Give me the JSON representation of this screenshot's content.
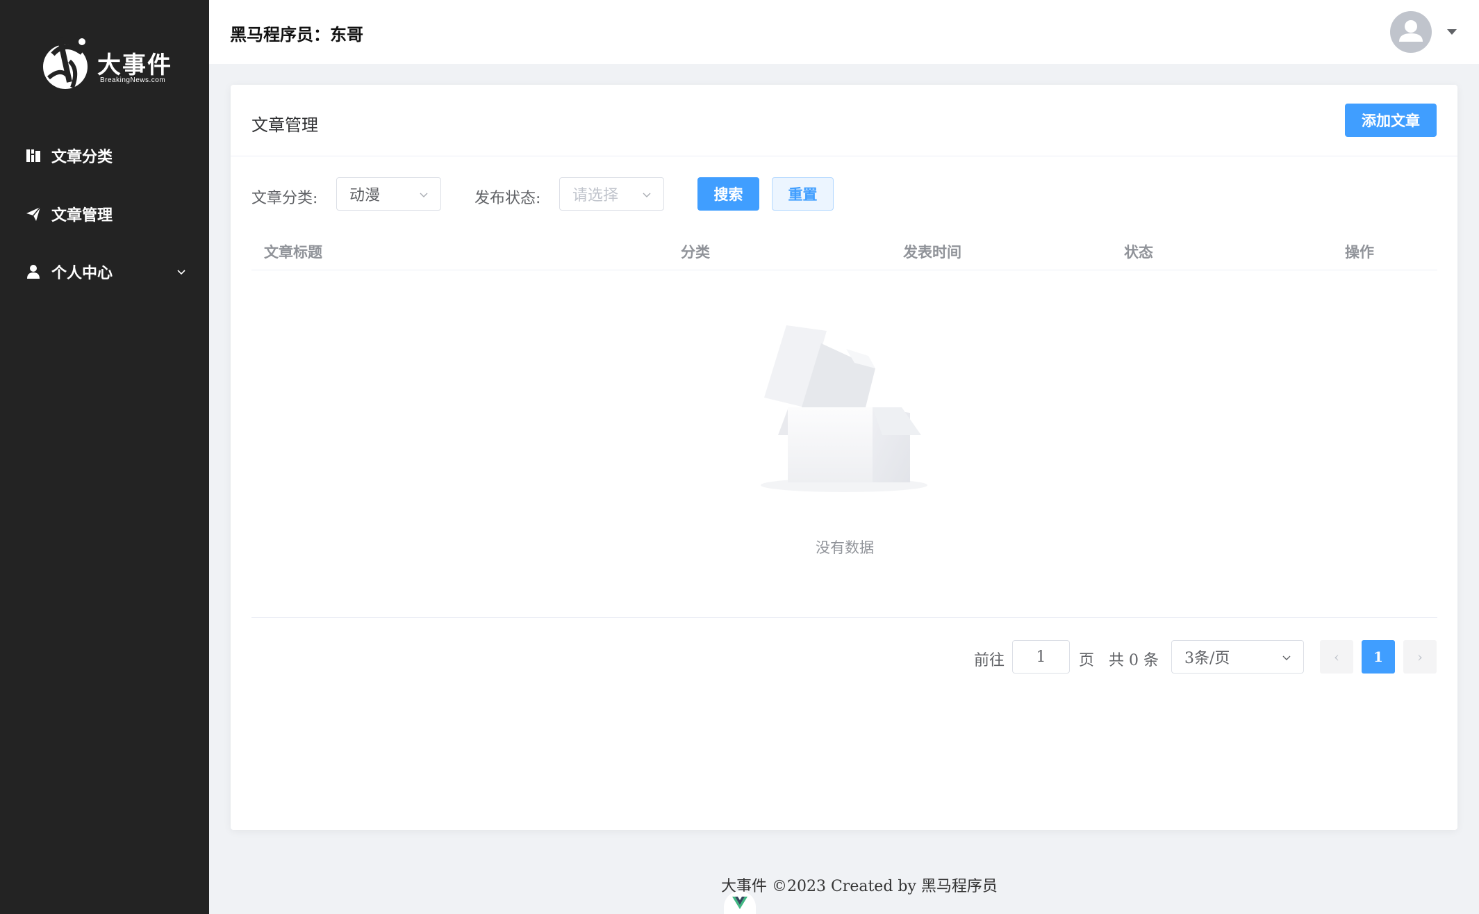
{
  "brand": {
    "name": "大事件",
    "sub": "BreakingNews.com"
  },
  "sidebar": {
    "items": [
      {
        "label": "文章分类",
        "icon": "book-icon"
      },
      {
        "label": "文章管理",
        "icon": "send-icon"
      },
      {
        "label": "个人中心",
        "icon": "user-icon",
        "expandable": true
      }
    ]
  },
  "header": {
    "title": "黑马程序员：东哥"
  },
  "card": {
    "title": "文章管理",
    "add_button": "添加文章"
  },
  "filters": {
    "category_label": "文章分类:",
    "category_value": "动漫",
    "status_label": "发布状态:",
    "status_placeholder": "请选择",
    "search_button": "搜索",
    "reset_button": "重置"
  },
  "table": {
    "columns": [
      "文章标题",
      "分类",
      "发表时间",
      "状态",
      "操作"
    ],
    "rows": [],
    "empty_text": "没有数据"
  },
  "pagination": {
    "goto_label": "前往",
    "goto_value": "1",
    "page_unit": "页",
    "total_text": "共 0 条",
    "page_size": "3条/页",
    "current_page": "1",
    "prev": "‹",
    "next": "›"
  },
  "footer": {
    "text": "大事件 ©2023 Created by 黑马程序员"
  },
  "colors": {
    "sidebar_bg": "#232323",
    "primary": "#409eff",
    "page_bg": "#f0f2f5"
  }
}
